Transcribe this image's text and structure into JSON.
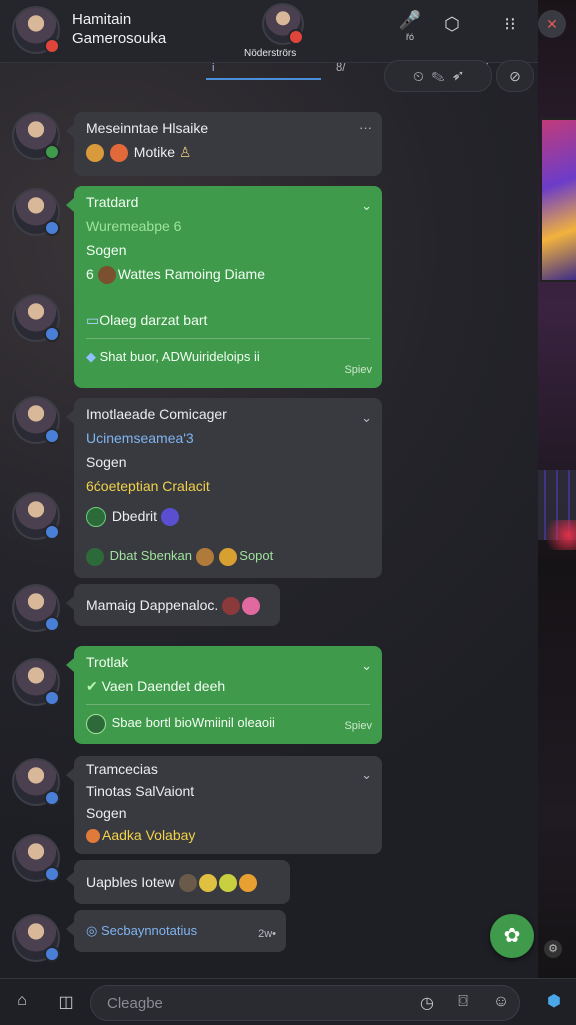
{
  "header": {
    "title_line1": "Hamitain",
    "title_line2": "Gamerosouka",
    "center_name": "Nöderströrs",
    "mic_label": "řó",
    "colors": {
      "bar": "#25262c",
      "accent_green": "#3f9a4b",
      "badge_red": "#e0453a"
    }
  },
  "subbar": {
    "text": "i                                            Ś       ť",
    "right_text": "ȣ/"
  },
  "messages": [
    {
      "line1": "Meseinntae Hlsaike",
      "line2": "Motike"
    },
    {
      "line1": "Tratdard",
      "line2": "Wuremeabpe 6",
      "line3": "Sogen",
      "line4": "Wattes Ramoing Diame",
      "line5": "Olaeg darzat bart",
      "line6": "Shat buor, ADWuirideloips ii",
      "time": "Spiev"
    },
    {
      "line1": "Imotlaeade Comicager",
      "line2": "Ucinemseamea'3",
      "line3": "Sogen",
      "line4": "6ćoeteptian Cralacit",
      "line5": "Dbedrit",
      "line6": "Dbat Sbenkan",
      "line6b": "Sopot"
    },
    {
      "line1": "Mamaig Dappenaloc."
    },
    {
      "line1": "Trotlak",
      "line2": "Vaen Daendet deeh",
      "line3": "Sbae bortl bioWmiinil oleaoii",
      "time": "Spiev"
    },
    {
      "line1": "Tramcecias",
      "line2": "Tinotas SalVaiont",
      "line3": "Sogen",
      "line4": "Aadka Volabay"
    },
    {
      "line1": "Uapbles Iotew"
    },
    {
      "line1": "Secbaynnotatius",
      "time": "2w•"
    }
  ],
  "composer": {
    "placeholder": "Cleagbe"
  }
}
